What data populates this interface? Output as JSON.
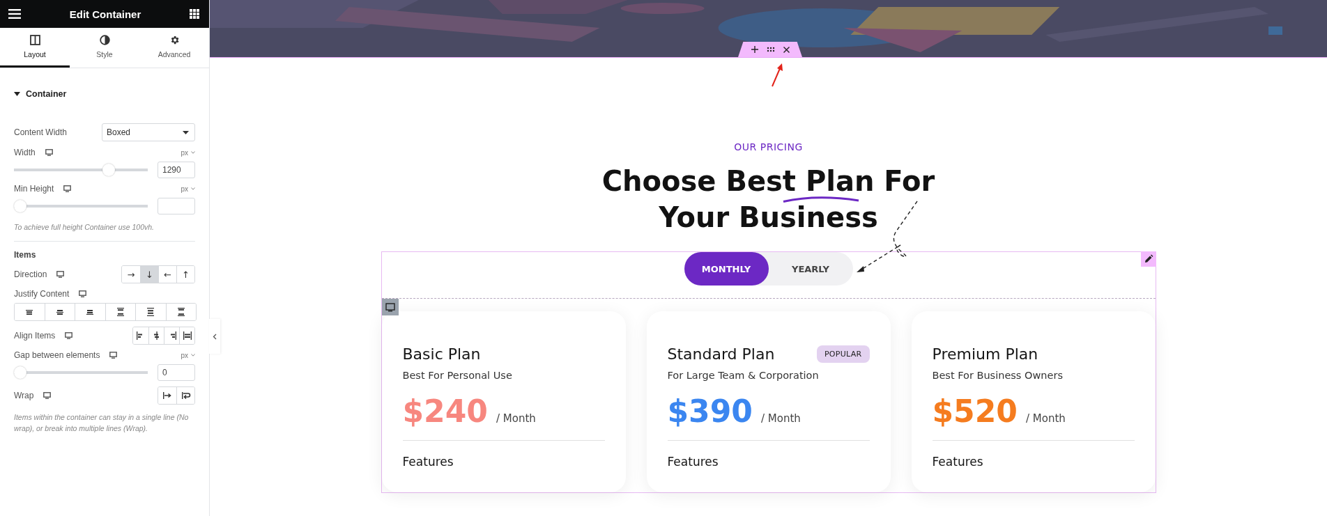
{
  "panel": {
    "title": "Edit Container",
    "tabs": [
      {
        "label": "Layout",
        "selected": true
      },
      {
        "label": "Style",
        "selected": false
      },
      {
        "label": "Advanced",
        "selected": false
      }
    ],
    "section": {
      "title": "Container",
      "expanded": true
    },
    "controls": [
      {
        "kind": "select",
        "label": "Content Width",
        "value": "Boxed"
      },
      {
        "kind": "slider",
        "label": "Width",
        "unit": "px",
        "level": 0.73,
        "value": "1290"
      },
      {
        "kind": "slider",
        "label": "Min Height",
        "unit": "px",
        "level": 0
      },
      {
        "kind": "hint",
        "text": "To achieve full height Container use 100vh."
      },
      {
        "kind": "divider"
      },
      {
        "kind": "heading",
        "label": "Items"
      },
      {
        "kind": "direction",
        "label": "Direction",
        "options": [
          {
            "label": "→",
            "selected": false
          },
          {
            "label": "↓",
            "selected": true
          },
          {
            "label": "←",
            "selected": false
          },
          {
            "label": "↑",
            "selected": false
          }
        ]
      },
      {
        "kind": "justify",
        "label": "Justify Content",
        "options": [
          {
            "selected": false
          },
          {
            "selected": false
          },
          {
            "selected": false
          },
          {
            "selected": false
          },
          {
            "selected": false
          },
          {
            "selected": false
          }
        ]
      },
      {
        "kind": "align",
        "label": "Align Items",
        "options": [
          {
            "selected": false
          },
          {
            "selected": false
          },
          {
            "selected": false
          },
          {
            "selected": false
          }
        ]
      },
      {
        "kind": "slider",
        "label": "Gap between elements",
        "unit": "px",
        "level": 0,
        "value": "0"
      },
      {
        "kind": "wrap",
        "label": "Wrap",
        "options": [
          {
            "selected": false
          },
          {
            "selected": false
          }
        ]
      },
      {
        "kind": "hint",
        "text": "Items within the container can stay in a single line (No wrap), or break into multiple lines (Wrap)."
      }
    ]
  },
  "page": {
    "eyebrow": "OUR PRICING",
    "title_lines": [
      "Choose Best Plan For",
      "Your Business"
    ],
    "billing": [
      {
        "label": "MONTHLY",
        "selected": true
      },
      {
        "label": "YEARLY",
        "selected": false
      }
    ],
    "plans": [
      {
        "name": "Basic Plan",
        "subtitle": "Best For Personal Use",
        "price": "$240",
        "period": "/ Month",
        "color": "#f7877f",
        "section": "Features"
      },
      {
        "name": "Standard Plan",
        "badge": "POPULAR",
        "subtitle": "For Large Team & Corporation",
        "price": "$390",
        "period": "/ Month",
        "color": "#3b86f0",
        "section": "Features"
      },
      {
        "name": "Premium Plan",
        "subtitle": "Best For Business Owners",
        "price": "$520",
        "period": "/ Month",
        "color": "#f57c1f",
        "section": "Features"
      }
    ]
  }
}
